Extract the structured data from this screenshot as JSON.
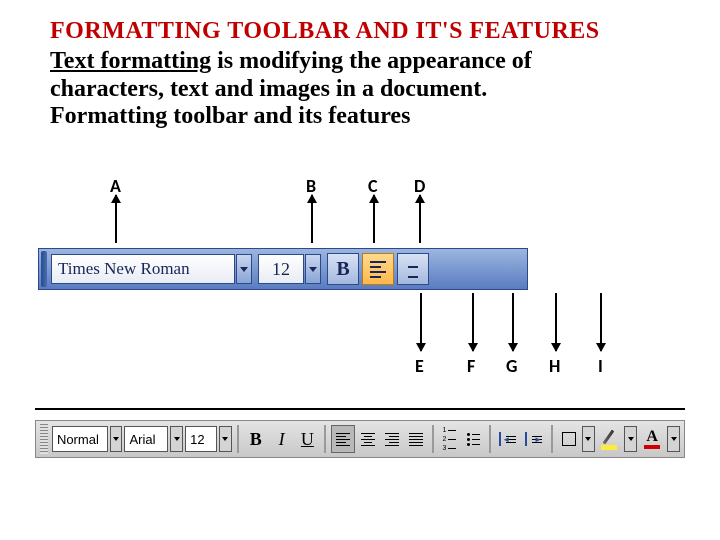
{
  "title": "FORMATTING TOOLBAR AND IT'S FEATURES",
  "para": {
    "lead": "Text formatting",
    "rest1": " is modifying the appearance of characters, text and images in a document.",
    "line3": "Formatting toolbar and its features"
  },
  "labels_top": {
    "A": "A",
    "B": "B",
    "C": "C",
    "D": "D"
  },
  "labels_bottom": {
    "E": "E",
    "F": "F",
    "G": "G",
    "H": "H",
    "I": "I"
  },
  "toolbar1": {
    "font": "Times New Roman",
    "size": "12",
    "bold": "B"
  },
  "toolbar2": {
    "style": "Normal",
    "font": "Arial",
    "size": "12",
    "B": "B",
    "I": "I",
    "U": "U",
    "A": "A"
  }
}
